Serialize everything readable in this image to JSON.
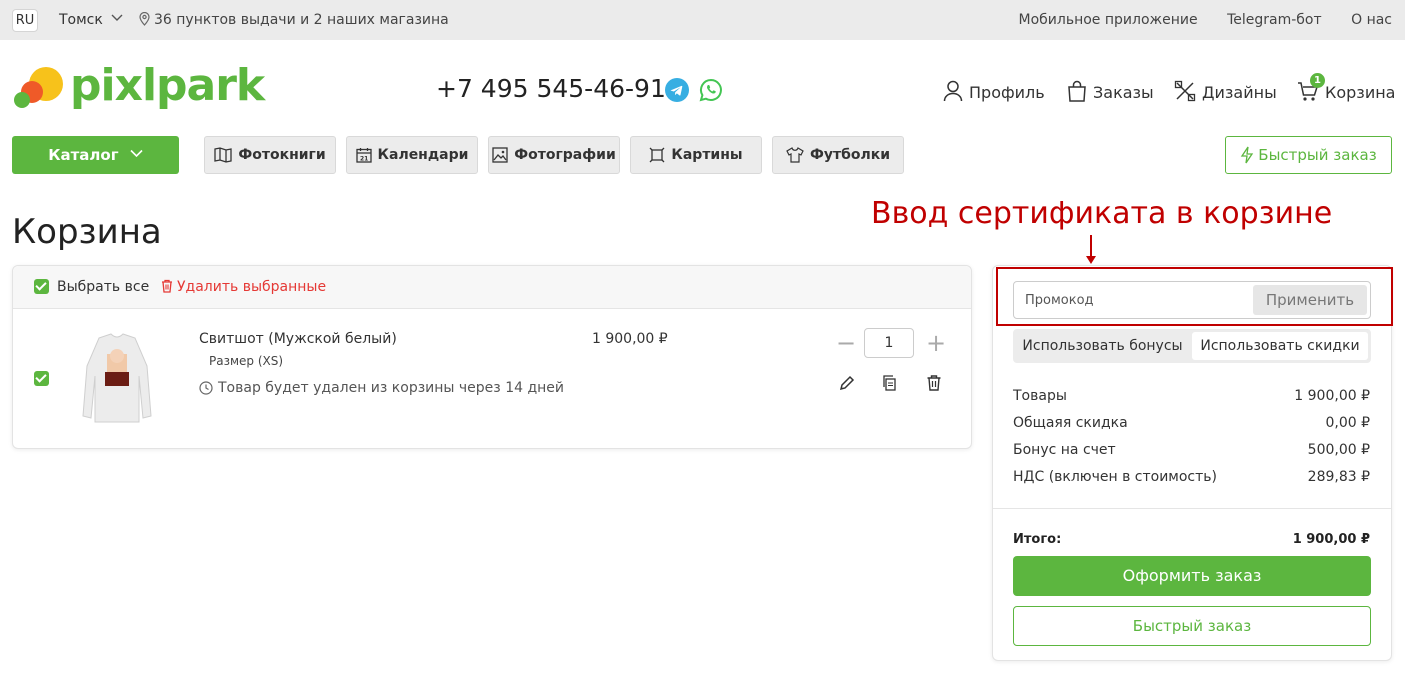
{
  "topbar": {
    "lang": "RU",
    "city": "Томск",
    "points": "36 пунктов выдачи и 2 наших магазина",
    "links": [
      "Мобильное приложение",
      "Telegram-бот",
      "О нас"
    ]
  },
  "header": {
    "logo_text": "pixlpark",
    "phone": "+7 495 545-46-91",
    "nav": {
      "profile": "Профиль",
      "orders": "Заказы",
      "designs": "Дизайны",
      "cart": "Корзина",
      "cart_count": "1"
    }
  },
  "catalog_row": {
    "catalog": "Каталог",
    "categories": [
      "Фотокниги",
      "Календари",
      "Фотографии",
      "Картины",
      "Футболки"
    ],
    "quick_order": "Быстрый заказ"
  },
  "page_title": "Корзина",
  "annotation": "Ввод сертификата в корзине",
  "cart": {
    "select_all": "Выбрать все",
    "delete_selected": "Удалить выбранные",
    "items": [
      {
        "name": "Свитшот (Мужской белый)",
        "size": "Размер (XS)",
        "note": "Товар будет удален из корзины через 14 дней",
        "price": "1 900,00 ₽",
        "qty": "1"
      }
    ]
  },
  "summary": {
    "promo_placeholder": "Промокод",
    "apply": "Применить",
    "tabs": [
      "Использовать бонусы",
      "Использовать скидки"
    ],
    "rows": [
      {
        "label": "Товары",
        "value": "1 900,00 ₽"
      },
      {
        "label": "Общаяя скидка",
        "value": "0,00 ₽"
      },
      {
        "label": "Бонус на счет",
        "value": "500,00 ₽"
      },
      {
        "label": "НДС (включен в стоимость)",
        "value": "289,83 ₽"
      }
    ],
    "total_label": "Итого:",
    "total_value": "1 900,00 ₽",
    "checkout": "Оформить заказ",
    "quick_order": "Быстрый заказ"
  },
  "colors": {
    "brand_green": "#5cb63f",
    "annotation_red": "#c00000",
    "delete_red": "#e53935"
  }
}
